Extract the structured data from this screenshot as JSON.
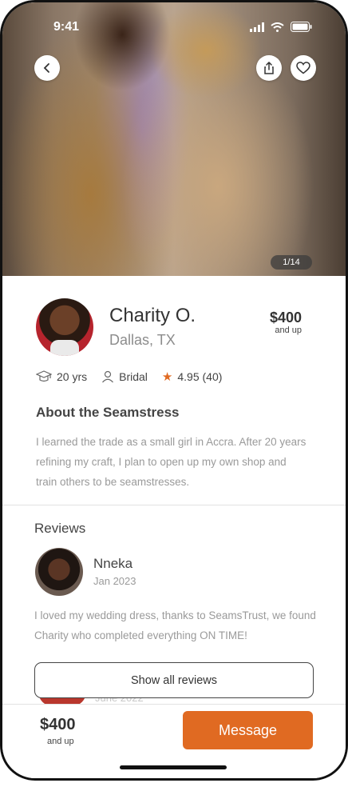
{
  "status_bar": {
    "time": "9:41"
  },
  "hero": {
    "photo_counter": "1/14"
  },
  "profile": {
    "name": "Charity O.",
    "location": "Dallas, TX",
    "price": "$400",
    "price_note": "and up",
    "stats": {
      "experience": "20 yrs",
      "specialty": "Bridal",
      "rating": "4.95 (40)"
    }
  },
  "about": {
    "title": "About the Seamstress",
    "text": "I learned the trade as a small girl in Accra. After 20 years refining my craft, I plan to open up my own shop and train others to be seamstresses."
  },
  "reviews": {
    "title": "Reviews",
    "items": [
      {
        "reviewer": "Nneka",
        "date": "Jan 2023",
        "text": "I loved my wedding dress, thanks to SeamsTrust, we found Charity who completed everything ON TIME!"
      },
      {
        "date": "June 2022"
      }
    ],
    "show_all_label": "Show all reviews"
  },
  "footer": {
    "price": "$400",
    "price_note": "and up",
    "message_label": "Message"
  },
  "colors": {
    "accent": "#e06a22"
  },
  "icons": [
    "back-icon",
    "share-icon",
    "heart-icon",
    "graduation-cap-icon",
    "person-icon",
    "star-icon",
    "signal-icon",
    "wifi-icon",
    "battery-icon"
  ]
}
